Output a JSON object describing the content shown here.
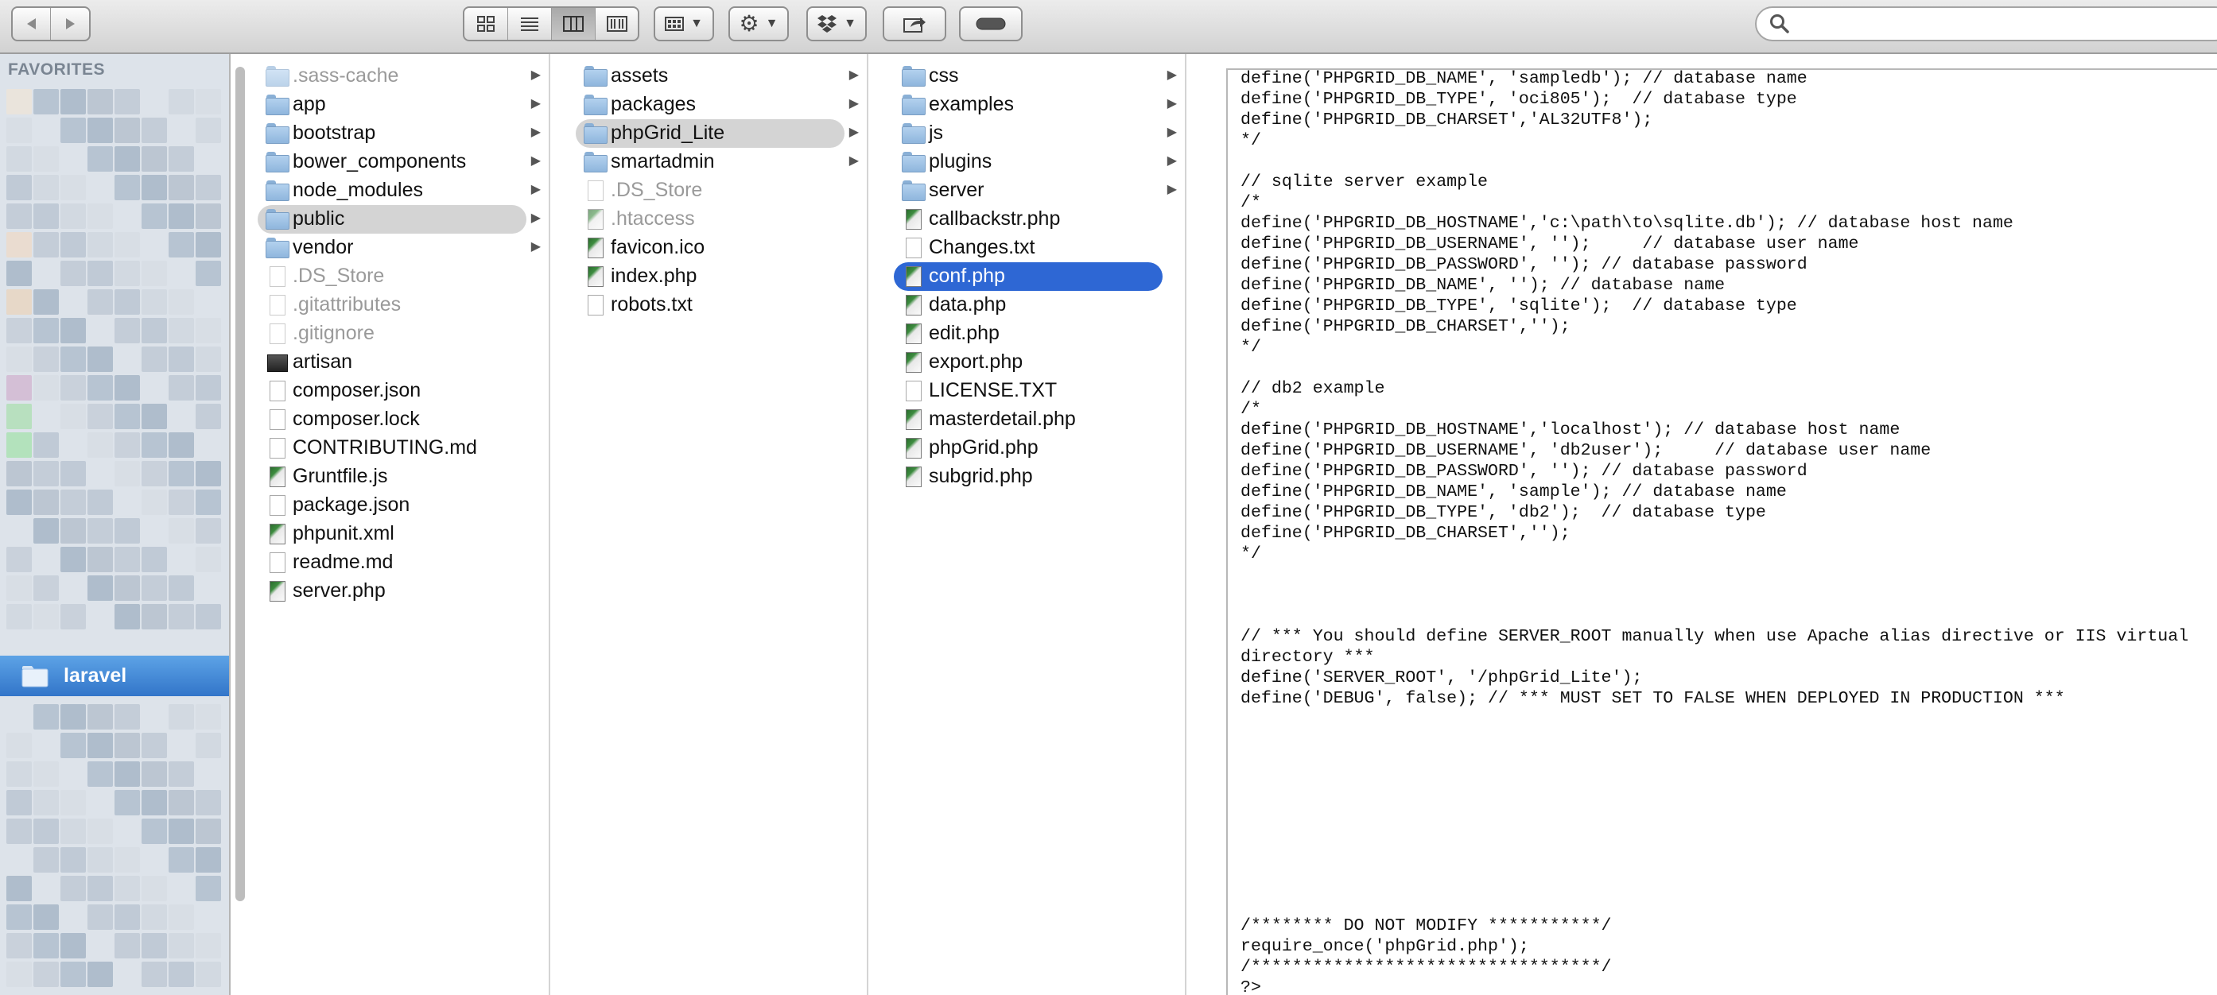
{
  "toolbar": {
    "nav": [
      "back-icon",
      "forward-icon"
    ],
    "view_buttons": [
      "icon-view-icon",
      "list-view-icon",
      "column-view-icon",
      "coverflow-view-icon"
    ],
    "active_view": "column-view-icon",
    "arrange": "arrange-icon",
    "action": "gear-icon",
    "dropbox": "dropbox-icon",
    "share": "share-icon",
    "tags": "tag-icon",
    "search_placeholder": ""
  },
  "sidebar": {
    "favorites_header": "FAVORITES",
    "selected_device": "laravel"
  },
  "columns": [
    {
      "items": [
        {
          "name": ".sass-cache",
          "kind": "folder",
          "hidden": true,
          "arrow": true
        },
        {
          "name": "app",
          "kind": "folder",
          "arrow": true
        },
        {
          "name": "bootstrap",
          "kind": "folder",
          "arrow": true
        },
        {
          "name": "bower_components",
          "kind": "folder",
          "arrow": true
        },
        {
          "name": "node_modules",
          "kind": "folder",
          "arrow": true
        },
        {
          "name": "public",
          "kind": "folder",
          "arrow": true,
          "selected": "grey"
        },
        {
          "name": "vendor",
          "kind": "folder",
          "arrow": true
        },
        {
          "name": ".DS_Store",
          "kind": "file",
          "hidden": true
        },
        {
          "name": ".gitattributes",
          "kind": "file",
          "hidden": true
        },
        {
          "name": ".gitignore",
          "kind": "file",
          "hidden": true
        },
        {
          "name": "artisan",
          "kind": "exec"
        },
        {
          "name": "composer.json",
          "kind": "file"
        },
        {
          "name": "composer.lock",
          "kind": "file"
        },
        {
          "name": "CONTRIBUTING.md",
          "kind": "file"
        },
        {
          "name": "Gruntfile.js",
          "kind": "php"
        },
        {
          "name": "package.json",
          "kind": "file"
        },
        {
          "name": "phpunit.xml",
          "kind": "php"
        },
        {
          "name": "readme.md",
          "kind": "file"
        },
        {
          "name": "server.php",
          "kind": "php"
        }
      ]
    },
    {
      "items": [
        {
          "name": "assets",
          "kind": "folder",
          "arrow": true
        },
        {
          "name": "packages",
          "kind": "folder",
          "arrow": true
        },
        {
          "name": "phpGrid_Lite",
          "kind": "folder",
          "arrow": true,
          "selected": "grey"
        },
        {
          "name": "smartadmin",
          "kind": "folder",
          "arrow": true
        },
        {
          "name": ".DS_Store",
          "kind": "file",
          "hidden": true
        },
        {
          "name": ".htaccess",
          "kind": "php",
          "hidden": true
        },
        {
          "name": "favicon.ico",
          "kind": "php"
        },
        {
          "name": "index.php",
          "kind": "php"
        },
        {
          "name": "robots.txt",
          "kind": "file"
        }
      ]
    },
    {
      "items": [
        {
          "name": "css",
          "kind": "folder",
          "arrow": true
        },
        {
          "name": "examples",
          "kind": "folder",
          "arrow": true
        },
        {
          "name": "js",
          "kind": "folder",
          "arrow": true
        },
        {
          "name": "plugins",
          "kind": "folder",
          "arrow": true
        },
        {
          "name": "server",
          "kind": "folder",
          "arrow": true
        },
        {
          "name": "callbackstr.php",
          "kind": "php"
        },
        {
          "name": "Changes.txt",
          "kind": "file"
        },
        {
          "name": "conf.php",
          "kind": "php",
          "selected": "blue"
        },
        {
          "name": "data.php",
          "kind": "php"
        },
        {
          "name": "edit.php",
          "kind": "php"
        },
        {
          "name": "export.php",
          "kind": "php"
        },
        {
          "name": "LICENSE.TXT",
          "kind": "file"
        },
        {
          "name": "masterdetail.php",
          "kind": "php"
        },
        {
          "name": "phpGrid.php",
          "kind": "php"
        },
        {
          "name": "subgrid.php",
          "kind": "php"
        }
      ]
    }
  ],
  "preview": {
    "code": "define('PHPGRID_DB_NAME', 'sampledb'); // database name\ndefine('PHPGRID_DB_TYPE', 'oci805');  // database type\ndefine('PHPGRID_DB_CHARSET','AL32UTF8');\n*/\n\n// sqlite server example\n/*\ndefine('PHPGRID_DB_HOSTNAME','c:\\path\\to\\sqlite.db'); // database host name\ndefine('PHPGRID_DB_USERNAME', '');     // database user name\ndefine('PHPGRID_DB_PASSWORD', ''); // database password\ndefine('PHPGRID_DB_NAME', ''); // database name\ndefine('PHPGRID_DB_TYPE', 'sqlite');  // database type\ndefine('PHPGRID_DB_CHARSET','');\n*/\n\n// db2 example\n/*\ndefine('PHPGRID_DB_HOSTNAME','localhost'); // database host name\ndefine('PHPGRID_DB_USERNAME', 'db2user');     // database user name\ndefine('PHPGRID_DB_PASSWORD', ''); // database password\ndefine('PHPGRID_DB_NAME', 'sample'); // database name\ndefine('PHPGRID_DB_TYPE', 'db2');  // database type\ndefine('PHPGRID_DB_CHARSET','');\n*/\n\n\n\n// *** You should define SERVER_ROOT manually when use Apache alias directive or IIS virtual\ndirectory ***\ndefine('SERVER_ROOT', '/phpGrid_Lite');\ndefine('DEBUG', false); // *** MUST SET TO FALSE WHEN DEPLOYED IN PRODUCTION ***\n\n\n\n\n\n\n\n\n\n\n/******** DO NOT MODIFY ***********/\nrequire_once('phpGrid.php');\n/**********************************/\n?>"
  },
  "colors": {
    "selection_blue": "#2e67d4",
    "sidebar_selected": "#3275c9",
    "sidebar_bg": "#dde3ea"
  }
}
